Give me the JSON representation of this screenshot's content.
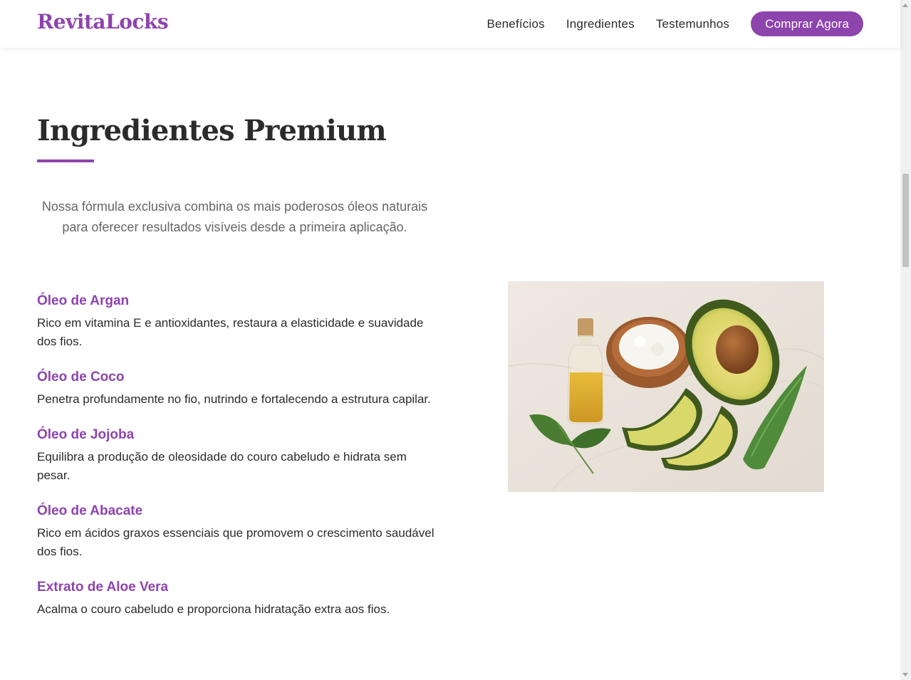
{
  "header": {
    "logo": "RevitaLocks",
    "nav": [
      {
        "label": "Benefícios"
      },
      {
        "label": "Ingredientes"
      },
      {
        "label": "Testemunhos"
      }
    ],
    "cta_label": "Comprar Agora"
  },
  "section": {
    "title": "Ingredientes Premium",
    "intro": "Nossa fórmula exclusiva combina os mais poderosos óleos naturais para oferecer resultados visíveis desde a primeira aplicação.",
    "ingredients": [
      {
        "name": "Óleo de Argan",
        "description": "Rico em vitamina E e antioxidantes, restaura a elasticidade e suavidade dos fios."
      },
      {
        "name": "Óleo de Coco",
        "description": "Penetra profundamente no fio, nutrindo e fortalecendo a estrutura capilar."
      },
      {
        "name": "Óleo de Jojoba",
        "description": "Equilibra a produção de oleosidade do couro cabeludo e hidrata sem pesar."
      },
      {
        "name": "Óleo de Abacate",
        "description": "Rico em ácidos graxos essenciais que promovem o crescimento saudável dos fios."
      },
      {
        "name": "Extrato de Aloe Vera",
        "description": "Acalma o couro cabeludo e proporciona hidratação extra aos fios."
      }
    ]
  },
  "colors": {
    "brand": "#8e44ad",
    "text": "#2b2b2b",
    "muted": "#666666"
  },
  "icons": {
    "product_image": "ingredients-photo"
  }
}
